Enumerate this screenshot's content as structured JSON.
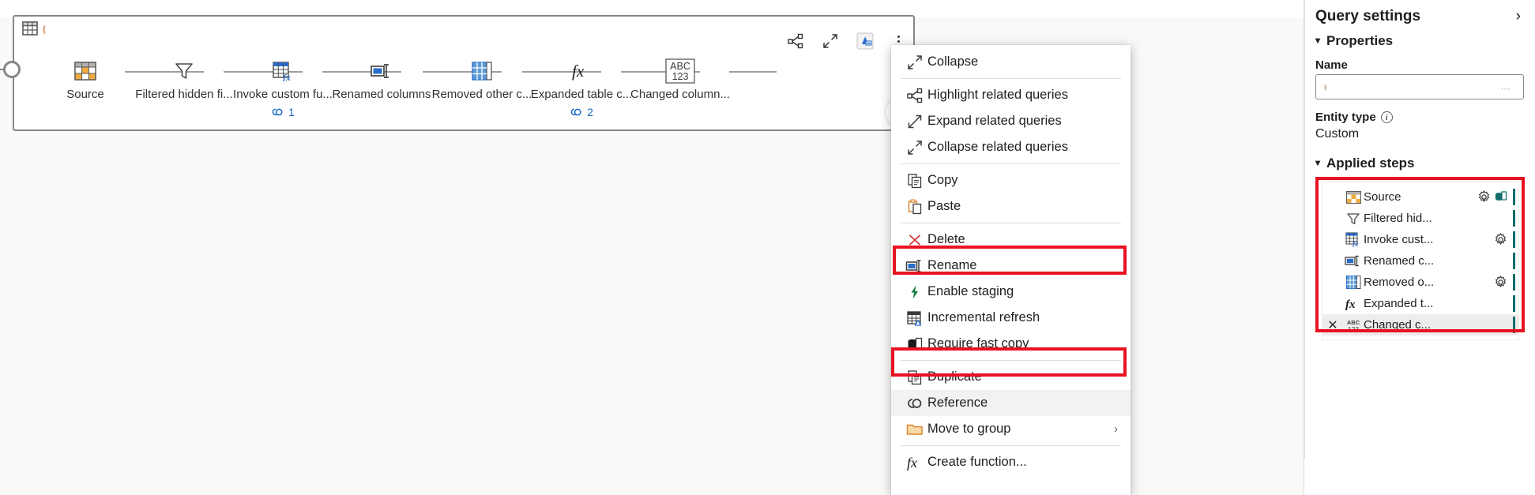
{
  "card": {
    "title": "(",
    "toolbar": [
      {
        "name": "highlight-related-queries-icon",
        "label": "Highlight related queries"
      },
      {
        "name": "collapse-icon",
        "label": "Collapse"
      },
      {
        "name": "staging-icon",
        "label": "Staging enabled"
      },
      {
        "name": "more-options-icon",
        "label": "More options"
      }
    ],
    "add_step_label": "+"
  },
  "steps": [
    {
      "label": "Source",
      "icon": "table-orange-icon",
      "refs": ""
    },
    {
      "label": "Filtered hidden fi...",
      "icon": "filter-icon",
      "refs": ""
    },
    {
      "label": "Invoke custom fu...",
      "icon": "invoke-function-icon",
      "refs": "1"
    },
    {
      "label": "Renamed columns",
      "icon": "rename-icon",
      "refs": ""
    },
    {
      "label": "Removed other c...",
      "icon": "table-blue-icon",
      "refs": ""
    },
    {
      "label": "Expanded table c...",
      "icon": "fx-icon",
      "refs": "2"
    },
    {
      "label": "Changed column...",
      "icon": "abc123-icon",
      "refs": ""
    }
  ],
  "context_menu": {
    "groups": [
      [
        {
          "label": "Collapse",
          "icon": "collapse-icon",
          "highlight": false,
          "selected": false,
          "submenu": ""
        }
      ],
      [
        {
          "label": "Highlight related queries",
          "icon": "highlight-related-queries-icon",
          "highlight": false,
          "selected": false,
          "submenu": ""
        },
        {
          "label": "Expand related queries",
          "icon": "expand-related-queries-icon",
          "highlight": false,
          "selected": false,
          "submenu": ""
        },
        {
          "label": "Collapse related queries",
          "icon": "collapse-related-queries-icon",
          "highlight": false,
          "selected": false,
          "submenu": ""
        }
      ],
      [
        {
          "label": "Copy",
          "icon": "copy-icon",
          "highlight": false,
          "selected": false,
          "submenu": ""
        },
        {
          "label": "Paste",
          "icon": "paste-icon",
          "highlight": false,
          "selected": false,
          "submenu": ""
        }
      ],
      [
        {
          "label": "Delete",
          "icon": "delete-icon",
          "highlight": false,
          "selected": false,
          "submenu": ""
        },
        {
          "label": "Rename",
          "icon": "rename-icon",
          "highlight": false,
          "selected": false,
          "submenu": ""
        },
        {
          "label": "Enable staging",
          "icon": "lightning-icon",
          "highlight": true,
          "selected": false,
          "submenu": ""
        },
        {
          "label": "Incremental refresh",
          "icon": "incremental-refresh-icon",
          "highlight": false,
          "selected": false,
          "submenu": ""
        },
        {
          "label": "Require fast copy",
          "icon": "fast-copy-icon",
          "highlight": false,
          "selected": false,
          "submenu": ""
        }
      ],
      [
        {
          "label": "Duplicate",
          "icon": "duplicate-icon",
          "highlight": false,
          "selected": false,
          "submenu": ""
        },
        {
          "label": "Reference",
          "icon": "reference-icon",
          "highlight": true,
          "selected": true,
          "submenu": ""
        },
        {
          "label": "Move to group",
          "icon": "folder-icon",
          "highlight": false,
          "selected": false,
          "submenu": "›"
        }
      ],
      [
        {
          "label": "Create function...",
          "icon": "fx-icon",
          "highlight": false,
          "selected": false,
          "submenu": ""
        }
      ]
    ]
  },
  "query_settings": {
    "title": "Query settings",
    "collapse_glyph": "›",
    "properties": {
      "section_label": "Properties",
      "name_label": "Name",
      "name_value": "ı",
      "name_right": "...",
      "entity_type_label": "Entity type",
      "entity_type_value": "Custom"
    },
    "applied_steps": {
      "section_label": "Applied steps",
      "items": [
        {
          "label": "Source",
          "icon": "table-orange-icon",
          "gear": true,
          "db": true,
          "selected": false,
          "delete": false
        },
        {
          "label": "Filtered hid...",
          "icon": "filter-icon",
          "gear": false,
          "db": false,
          "selected": false,
          "delete": false
        },
        {
          "label": "Invoke cust...",
          "icon": "invoke-function-icon",
          "gear": true,
          "db": false,
          "selected": false,
          "delete": false
        },
        {
          "label": "Renamed c...",
          "icon": "rename-icon",
          "gear": false,
          "db": false,
          "selected": false,
          "delete": false
        },
        {
          "label": "Removed o...",
          "icon": "table-blue-icon",
          "gear": true,
          "db": false,
          "selected": false,
          "delete": false
        },
        {
          "label": "Expanded t...",
          "icon": "fx-icon",
          "gear": false,
          "db": false,
          "selected": false,
          "delete": false
        },
        {
          "label": "Changed c...",
          "icon": "abc123-icon",
          "gear": false,
          "db": false,
          "selected": true,
          "delete": true
        }
      ]
    }
  },
  "colors": {
    "accent": "#0f6cbd",
    "highlight_red": "#e81123",
    "step_bar_teal": "#0f6c69",
    "orange": "#d9822b",
    "canvas_bg": "#faf9f8"
  }
}
